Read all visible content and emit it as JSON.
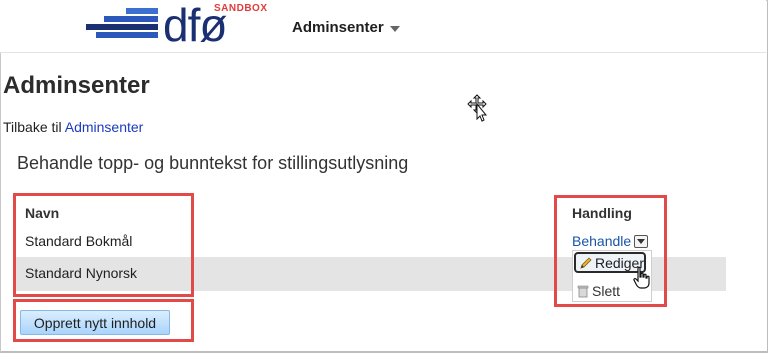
{
  "header": {
    "logo_text": "dfø",
    "env_badge": "SANDBOX",
    "menu_label": "Adminsenter",
    "colors": {
      "logo_navy": "#1b2f73",
      "logo_blue": "#3b6fd0",
      "badge": "#e23b3b"
    }
  },
  "page": {
    "title": "Adminsenter",
    "back_prefix": "Tilbake til",
    "back_link": "Adminsenter",
    "section_title": "Behandle topp- og bunntekst for stillingsutlysning"
  },
  "table": {
    "columns": [
      "Navn",
      "Handling"
    ],
    "rows": [
      {
        "name": "Standard Bokmål"
      },
      {
        "name": "Standard Nynorsk"
      }
    ],
    "action_label": "Behandle",
    "action_menu": [
      "Rediger",
      "Slett"
    ]
  },
  "actions": {
    "create_label": "Opprett nytt innhold"
  },
  "icons": [
    "chevron-down-icon",
    "dropdown-arrow-icon",
    "pencil-icon",
    "trash-icon",
    "hand-pointer-icon",
    "move-cursor-icon"
  ],
  "colors": {
    "link": "#1a3bbf",
    "highlight": "#e24a4a",
    "row_shade": "#e4e4e4",
    "button_blue": "#a9d4fb"
  }
}
